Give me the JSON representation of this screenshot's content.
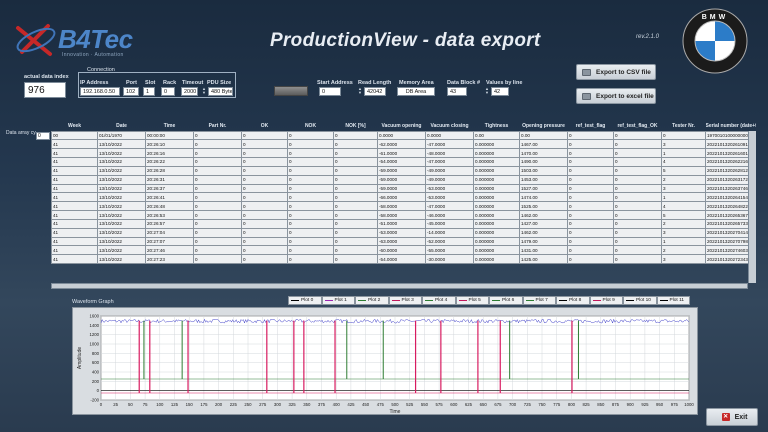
{
  "header": {
    "logo_text": "B4Tec",
    "logo_sub": "Innovation · Automation",
    "title": "ProductionView - data export",
    "version": "rev.2.1.0",
    "bmw_letters": "BMW"
  },
  "actual_index": {
    "label": "actual data index",
    "value": "976"
  },
  "connection": {
    "label": "Connection",
    "ip": {
      "label": "IP Address",
      "value": "192.168.0.50"
    },
    "port": {
      "label": "Port",
      "value": "102"
    },
    "slot": {
      "label": "Slot",
      "value": "1"
    },
    "rack": {
      "label": "Rack",
      "value": "0"
    },
    "timeout": {
      "label": "Timeout",
      "value": "2000"
    },
    "pdu": {
      "label": "PDU Size",
      "value": "480 Bytes"
    }
  },
  "params": {
    "start_address": {
      "label": "Start Address",
      "value": "0"
    },
    "read_length": {
      "label": "Read Length",
      "value": "42042"
    },
    "memory_area": {
      "label": "Memory Area",
      "value": "DB Area"
    },
    "data_block": {
      "label": "Data Block #",
      "value": "43"
    },
    "values_by_line": {
      "label": "Values by line",
      "value": "42"
    }
  },
  "buttons": {
    "csv": "Export to CSV file",
    "excel": "Export to excel file",
    "exit": "Exit"
  },
  "table": {
    "side_label": "Data array cy...",
    "index_value": "0",
    "columns": [
      "Week",
      "Date",
      "Time",
      "Part Nr.",
      "OK",
      "NOK",
      "NOK [%]",
      "Vacuum opening",
      "Vacuum closing",
      "Tightness",
      "Opening pressure",
      "ref_test_flag",
      "ref_test_flag_OK",
      "Tester Nr.",
      "Serial number (date+time)"
    ],
    "rows": [
      [
        "00",
        "01/01/1970",
        "00:00:00",
        "0",
        "0",
        "0",
        "0",
        "0.0000",
        "0.0000",
        "0.00",
        "0.00",
        "0",
        "0",
        "0",
        "19700101000000000"
      ],
      [
        "41",
        "13/10/2022",
        "20:26:10",
        "0",
        "0",
        "0",
        "0",
        "-62.0000",
        "-47.0000",
        "0.000000",
        "1467.00",
        "0",
        "0",
        "3",
        "20221013202610912"
      ],
      [
        "41",
        "13/10/2022",
        "20:26:16",
        "0",
        "0",
        "0",
        "0",
        "-61.0000",
        "-48.0000",
        "0.000000",
        "1470.00",
        "0",
        "0",
        "1",
        "20221013202616014"
      ],
      [
        "41",
        "13/10/2022",
        "20:26:22",
        "0",
        "0",
        "0",
        "0",
        "-54.0000",
        "-47.0000",
        "0.000000",
        "1490.00",
        "0",
        "0",
        "4",
        "20221013202622166"
      ],
      [
        "41",
        "13/10/2022",
        "20:26:28",
        "0",
        "0",
        "0",
        "0",
        "-59.0000",
        "-49.0000",
        "0.000000",
        "1503.00",
        "0",
        "0",
        "5",
        "20221013202628128"
      ],
      [
        "41",
        "13/10/2022",
        "20:26:31",
        "0",
        "0",
        "0",
        "0",
        "-59.0000",
        "-49.0000",
        "0.000000",
        "1453.00",
        "0",
        "0",
        "2",
        "20221013202631728"
      ],
      [
        "41",
        "13/10/2022",
        "20:26:37",
        "0",
        "0",
        "0",
        "0",
        "-59.0000",
        "-53.0000",
        "0.000000",
        "1527.00",
        "0",
        "0",
        "3",
        "20221013202637465"
      ],
      [
        "41",
        "13/10/2022",
        "20:26:41",
        "0",
        "0",
        "0",
        "0",
        "-66.0000",
        "-53.0000",
        "0.000000",
        "1474.00",
        "0",
        "0",
        "1",
        "20221013202641546"
      ],
      [
        "41",
        "13/10/2022",
        "20:26:48",
        "0",
        "0",
        "0",
        "0",
        "-58.0000",
        "-47.0000",
        "0.000000",
        "1525.00",
        "0",
        "0",
        "4",
        "20221013202648226"
      ],
      [
        "41",
        "13/10/2022",
        "20:26:53",
        "0",
        "0",
        "0",
        "0",
        "-58.0000",
        "-46.0000",
        "0.000000",
        "1462.00",
        "0",
        "0",
        "5",
        "20221013202653678"
      ],
      [
        "41",
        "13/10/2022",
        "20:26:57",
        "0",
        "0",
        "0",
        "0",
        "-51.0000",
        "-45.0000",
        "0.000000",
        "1427.00",
        "0",
        "0",
        "2",
        "20221013202657336"
      ],
      [
        "41",
        "13/10/2022",
        "20:27:04",
        "0",
        "0",
        "0",
        "0",
        "-53.0000",
        "-14.0000",
        "0.000000",
        "1462.00",
        "0",
        "0",
        "3",
        "20221013202704142"
      ],
      [
        "41",
        "13/10/2022",
        "20:27:07",
        "0",
        "0",
        "0",
        "0",
        "-63.0000",
        "-52.0000",
        "0.000000",
        "1479.00",
        "0",
        "0",
        "1",
        "20221013202707984"
      ],
      [
        "41",
        "13/10/2022",
        "20:27:46",
        "0",
        "0",
        "0",
        "0",
        "-60.0000",
        "-55.0000",
        "0.000000",
        "1431.00",
        "0",
        "0",
        "2",
        "20221013202746032"
      ],
      [
        "41",
        "13/10/2022",
        "20:27:23",
        "0",
        "0",
        "0",
        "0",
        "-54.0000",
        "-30.0000",
        "0.000000",
        "1425.00",
        "0",
        "0",
        "3",
        "20221013202723438"
      ]
    ]
  },
  "chart_data": {
    "type": "line",
    "title": "Waveform Graph",
    "xlabel": "Time",
    "ylabel": "Amplitude",
    "xlim": [
      0,
      1000
    ],
    "ylim": [
      -200,
      1600
    ],
    "x_ticks": [
      0,
      25,
      50,
      75,
      100,
      125,
      150,
      175,
      200,
      225,
      250,
      275,
      300,
      325,
      350,
      375,
      400,
      425,
      450,
      475,
      500,
      525,
      550,
      575,
      600,
      625,
      650,
      675,
      700,
      725,
      750,
      775,
      800,
      825,
      850,
      875,
      900,
      925,
      950,
      975,
      1000
    ],
    "y_ticks": [
      -200,
      0,
      200,
      400,
      600,
      800,
      1000,
      1200,
      1400,
      1600
    ],
    "grid": true,
    "legend": [
      "Plot 0",
      "Plot 1",
      "Plot 2",
      "Plot 3",
      "Plot 4",
      "Plot 5",
      "Plot 6",
      "Plot 7",
      "Plot 8",
      "Plot 9",
      "Plot 10",
      "Plot 11"
    ],
    "legend_colors": [
      "#000000",
      "#9c27b0",
      "#2e7d32",
      "#c2185b",
      "#2e7d32",
      "#c2185b",
      "#2e7d32",
      "#2e7d32",
      "#000000",
      "#c2185b",
      "#000000",
      "#000000"
    ],
    "series": [
      {
        "name": "Plot 0",
        "color": "#3c3cc8",
        "base": 1490,
        "noise": 40
      },
      {
        "name": "Plot 1",
        "color": "#2e7d32",
        "base": 250
      },
      {
        "name": "Plot 2",
        "color": "#000000",
        "base": 0
      },
      {
        "name": "Plot 3",
        "color": "#d81b60",
        "base": -50
      }
    ],
    "pink_spikes": [
      65,
      83,
      148,
      282,
      328,
      345,
      398,
      535,
      578,
      641,
      679,
      801
    ],
    "green_spikes": [
      73,
      138,
      418,
      480,
      695,
      812
    ]
  }
}
